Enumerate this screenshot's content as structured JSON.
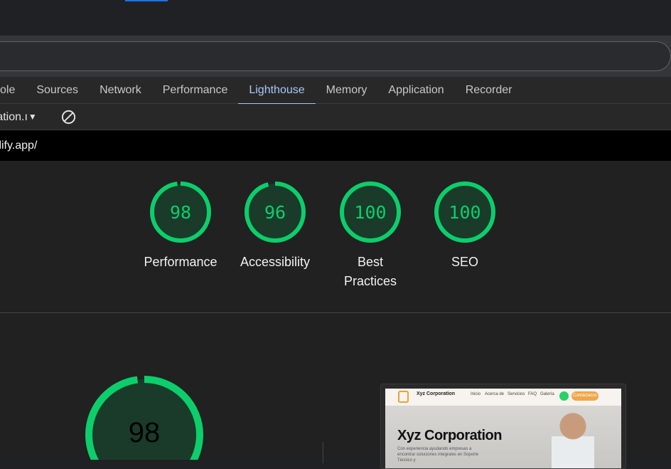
{
  "browser": {
    "tabs": [
      "sole",
      "Sources",
      "Network",
      "Performance",
      "Lighthouse",
      "Memory",
      "Application",
      "Recorder"
    ],
    "active_tab": "Lighthouse"
  },
  "toolbar": {
    "report_select": "ration.ı"
  },
  "report": {
    "url": "tlify.app/",
    "colors": {
      "pass": "#0cce6b",
      "pass_bg": "#1a3b2a"
    },
    "categories": [
      {
        "score": 98,
        "label": "Performance"
      },
      {
        "score": 96,
        "label": "Accessibility"
      },
      {
        "score": 100,
        "label": "Best Practices"
      },
      {
        "score": 100,
        "label": "SEO"
      }
    ],
    "main_score": 98
  },
  "screenshot": {
    "brand": "Xyz Corporation",
    "menu": [
      "Inicio",
      "Acerca de",
      "Servicios",
      "FAQ",
      "Galería"
    ],
    "cta": "Contáctanos",
    "hero_title": "Xyz Corporation",
    "hero_sub": "Con experiencia ayudando empresas a encontrar soluciones integrales en Soporte Técnico y"
  }
}
